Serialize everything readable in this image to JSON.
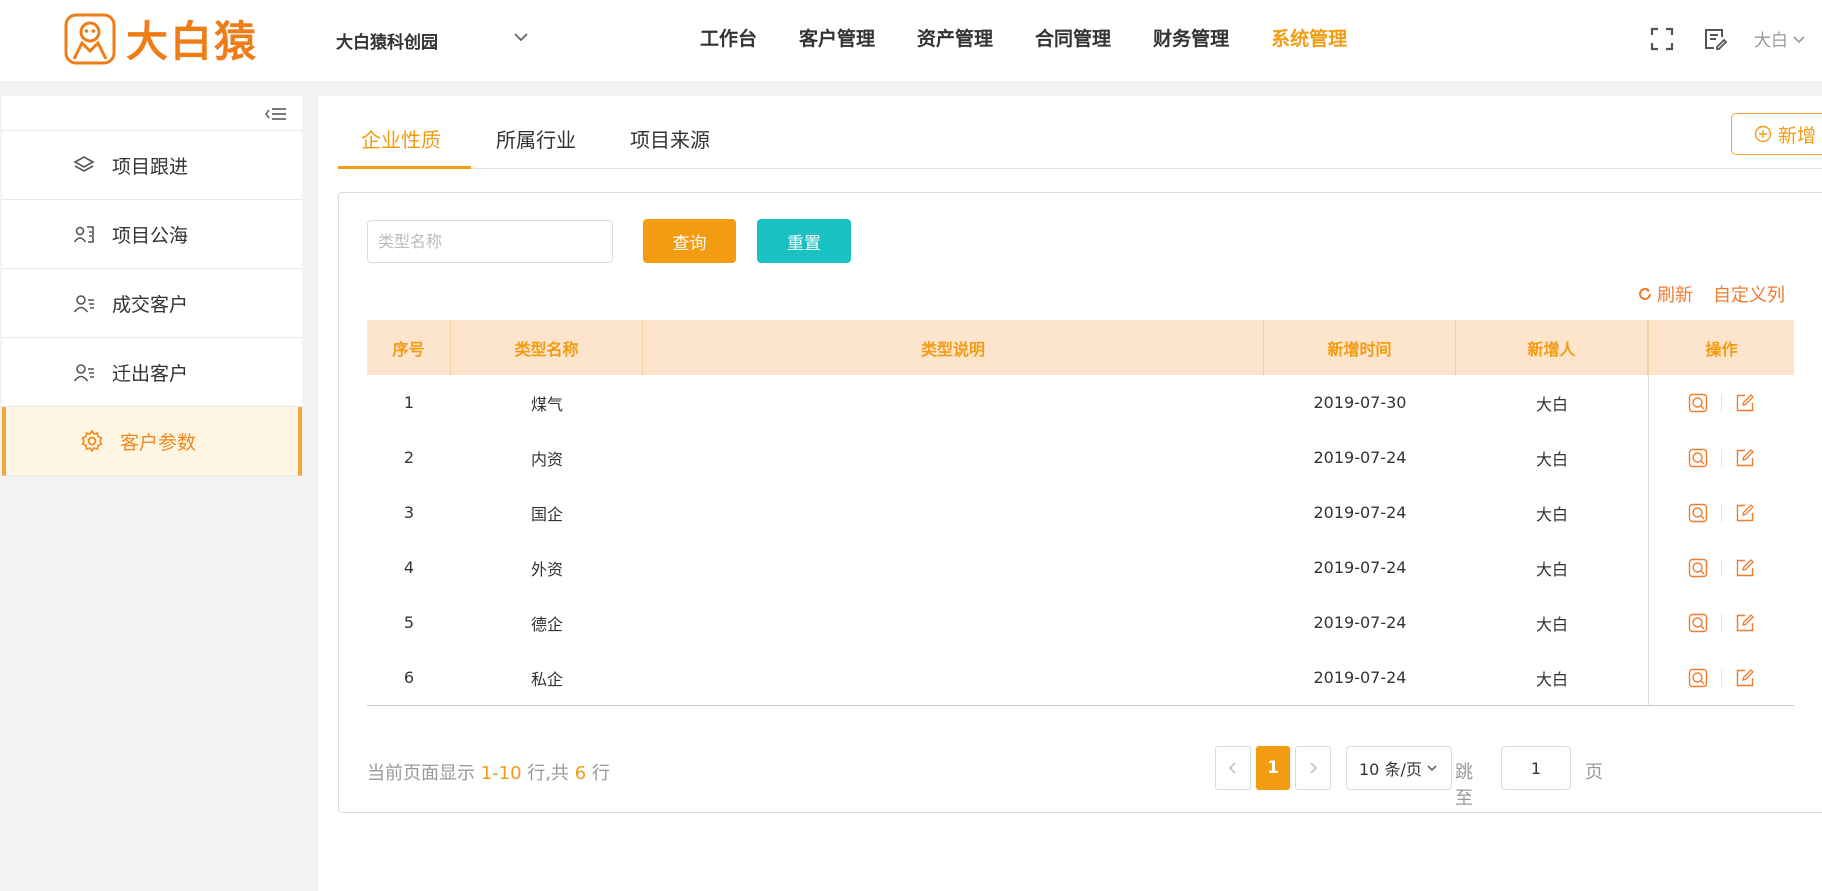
{
  "brand": {
    "name": "大白猿",
    "color": "#ef7d17"
  },
  "park": {
    "name": "大白猿科创园"
  },
  "nav": [
    {
      "label": "工作台"
    },
    {
      "label": "客户管理"
    },
    {
      "label": "资产管理"
    },
    {
      "label": "合同管理"
    },
    {
      "label": "财务管理"
    },
    {
      "label": "系统管理",
      "active": true
    }
  ],
  "user": {
    "name": "大白"
  },
  "sidebar": {
    "items": [
      {
        "label": "项目跟进",
        "icon": "layers-icon"
      },
      {
        "label": "项目公海",
        "icon": "contact-card-icon"
      },
      {
        "label": "成交客户",
        "icon": "user-list-icon"
      },
      {
        "label": "迁出客户",
        "icon": "user-list-icon"
      },
      {
        "label": "客户参数",
        "icon": "gear-icon",
        "active": true
      }
    ]
  },
  "tabs": [
    {
      "label": "企业性质",
      "active": true
    },
    {
      "label": "所属行业"
    },
    {
      "label": "项目来源"
    }
  ],
  "toolbar": {
    "add_label": "新增",
    "search_placeholder": "类型名称",
    "query_label": "查询",
    "reset_label": "重置",
    "refresh_label": "刷新",
    "custom_columns_label": "自定义列"
  },
  "table": {
    "columns": [
      "序号",
      "类型名称",
      "类型说明",
      "新增时间",
      "新增人",
      "操作"
    ],
    "rows": [
      {
        "index": "1",
        "name": "煤气",
        "desc": "",
        "date": "2019-07-30",
        "creator": "大白"
      },
      {
        "index": "2",
        "name": "内资",
        "desc": "",
        "date": "2019-07-24",
        "creator": "大白"
      },
      {
        "index": "3",
        "name": "国企",
        "desc": "",
        "date": "2019-07-24",
        "creator": "大白"
      },
      {
        "index": "4",
        "name": "外资",
        "desc": "",
        "date": "2019-07-24",
        "creator": "大白"
      },
      {
        "index": "5",
        "name": "德企",
        "desc": "",
        "date": "2019-07-24",
        "creator": "大白"
      },
      {
        "index": "6",
        "name": "私企",
        "desc": "",
        "date": "2019-07-24",
        "creator": "大白"
      }
    ]
  },
  "pagination": {
    "summary_prefix": "当前页面显示 ",
    "range": "1-10",
    "summary_middle": " 行,共 ",
    "total": "6",
    "summary_suffix": " 行",
    "current_page": "1",
    "page_size": "10 条/页",
    "jump_label": "跳至",
    "jump_value": "1",
    "page_unit": "页"
  },
  "colors": {
    "accent": "#f39c12",
    "teal": "#1ac1c3",
    "header_bg": "#fde4cc",
    "link": "#f07c2c"
  }
}
